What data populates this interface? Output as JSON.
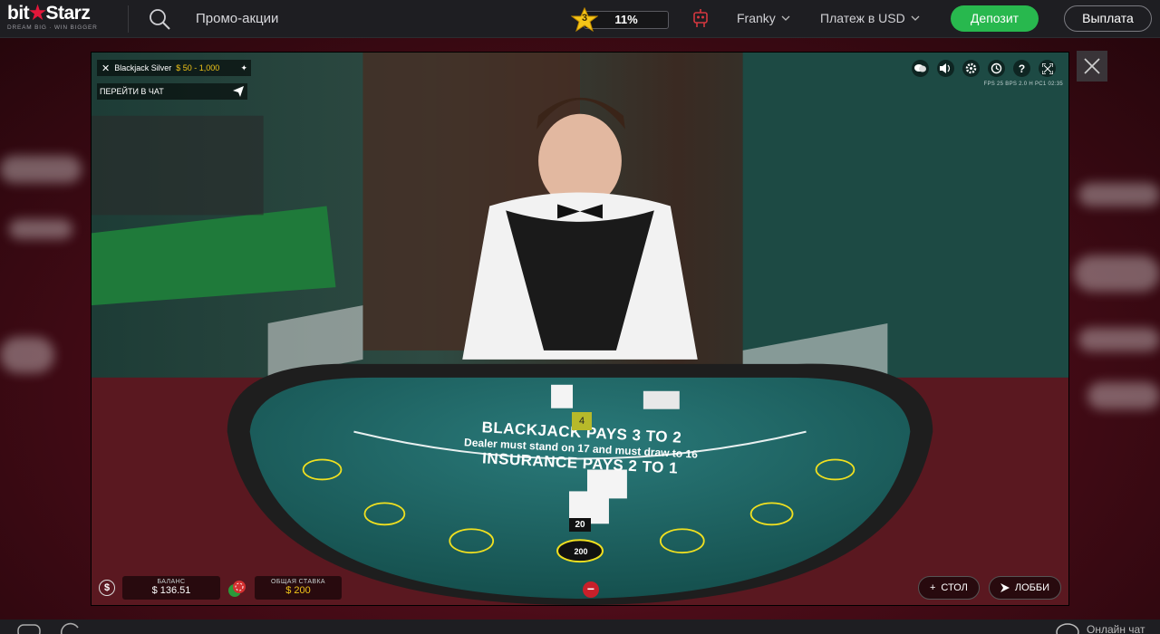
{
  "brand": {
    "name_part1": "bit",
    "name_part2": "Starz",
    "tagline": "DREAM BIG · WIN BIGGER",
    "accent": "#e3173a"
  },
  "header": {
    "promo_link": "Промо-акции",
    "level": {
      "number": "3",
      "progress_label": "11%",
      "progress": 0.11
    },
    "user": "Franky",
    "currency": "Платеж в USD",
    "deposit_label": "Депозит",
    "withdraw_label": "Выплата",
    "deposit_color": "#28b84e"
  },
  "game": {
    "table_name": "Blackjack Silver",
    "table_limits": "$ 50 - 1,000",
    "chat_label": "ПЕРЕЙТИ В ЧАТ",
    "stats_line": "FPS 25  BPS 2.0  H  PC1 02:35",
    "felt_line1": "BLACKJACK PAYS 3 TO 2",
    "felt_line2": "Dealer must stand on 17 and must draw to 16",
    "felt_line3": "INSURANCE PAYS 2 TO 1",
    "dealer_total": "4",
    "player_total": "20",
    "chip_value": "200",
    "balance_label": "БАЛАНС",
    "balance_value": "$ 136.51",
    "total_bet_label": "ОБЩАЯ СТАВКА",
    "total_bet_value": "$ 200",
    "table_button": "СТОЛ",
    "lobby_button": "ЛОББИ",
    "top_icons": [
      "chat-bubbles-icon",
      "volume-icon",
      "settings-icon",
      "history-icon",
      "help-icon",
      "fullscreen-icon"
    ]
  },
  "footer": {
    "chat_online": "Онлайн чат"
  }
}
